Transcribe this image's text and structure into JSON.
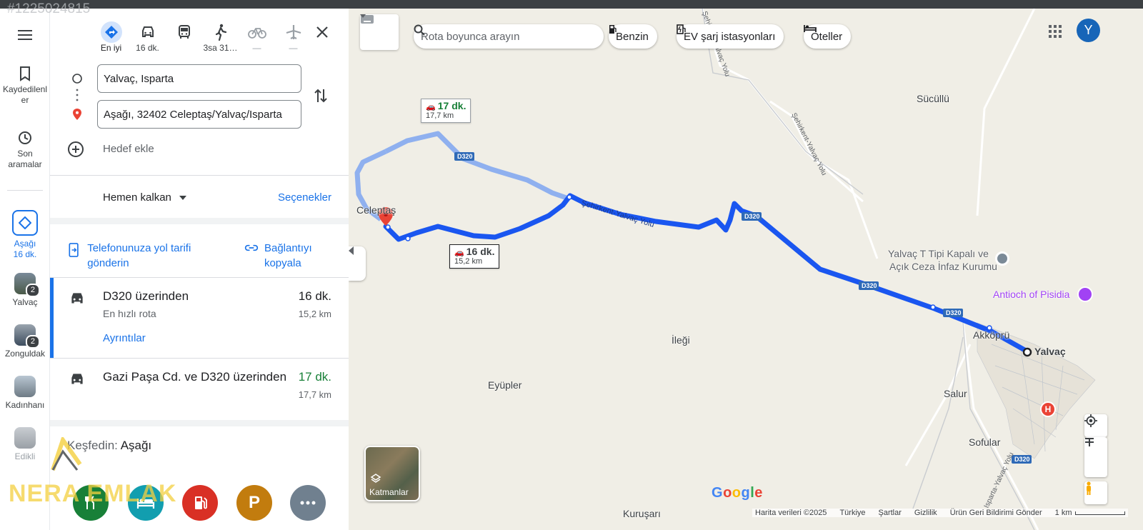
{
  "watermark_id": "#1225024815",
  "rail": {
    "saved_label": "Kaydedilenler",
    "recent_label": "Son aramalar",
    "current": {
      "label": "Aşağı",
      "sub": "16 dk."
    },
    "places": [
      {
        "label": "Yalvaç",
        "count": "2"
      },
      {
        "label": "Zonguldak",
        "count": "2"
      },
      {
        "label": "Kadınhanı",
        "count": ""
      },
      {
        "label": "Edikli",
        "count": ""
      }
    ]
  },
  "modes": [
    {
      "name": "best",
      "label": "En iyi",
      "icon": "directions-icon"
    },
    {
      "name": "car",
      "label": "16 dk.",
      "icon": "car-icon"
    },
    {
      "name": "transit",
      "label": "",
      "icon": "bus-icon"
    },
    {
      "name": "walk",
      "label": "3sa 31…",
      "icon": "walk-icon"
    },
    {
      "name": "bike",
      "label": "—",
      "icon": "bike-icon"
    },
    {
      "name": "flight",
      "label": "—",
      "icon": "plane-icon"
    }
  ],
  "origin": "Yalvaç, Isparta",
  "destination": "Aşağı, 32402 Celeptaş/Yalvaç/Isparta",
  "add_destination": "Hedef ekle",
  "depart_label": "Hemen kalkan",
  "options_label": "Seçenekler",
  "send_to_phone": "Telefonunuza yol tarifi gönderin",
  "copy_link": "Bağlantıyı kopyala",
  "routes": [
    {
      "title": "D320 üzerinden",
      "subtitle": "En hızlı rota",
      "time": "16 dk.",
      "distance": "15,2 km",
      "details": "Ayrıntılar",
      "selected": true
    },
    {
      "title": "Gazi Paşa Cd. ve D320 üzerinden",
      "subtitle": "",
      "time": "17 dk.",
      "distance": "17,7 km",
      "selected": false
    }
  ],
  "explore": {
    "prefix": "Keşfedin:",
    "place": "Aşağı"
  },
  "explore_buttons": [
    "restaurant",
    "hotel",
    "gas",
    "parking",
    "more"
  ],
  "map": {
    "search_placeholder": "Rota boyunca arayın",
    "chips": [
      "Benzin",
      "EV şarj istasyonları",
      "Oteller"
    ],
    "avatar": "Y",
    "callout_alt": {
      "time": "17 dk.",
      "distance": "17,7 km"
    },
    "callout_main": {
      "time": "16 dk.",
      "distance": "15,2 km"
    },
    "places": {
      "celeptas": "Celeptaş",
      "suculu": "Sücüllü",
      "prison1": "Yalvaç T Tipi Kapalı ve",
      "prison2": "Açık Ceza İnfaz Kurumu",
      "antioch": "Antioch of Pisidia",
      "akkopru": "Akköprü",
      "yalvac": "Yalvaç",
      "ilegi": "İleği",
      "eyupler": "Eyüpler",
      "salur": "Salur",
      "sofular": "Sofular",
      "kurusari": "Kuruşarı"
    },
    "roads": {
      "d320": "D320",
      "sehirkent": "Şehirkent-Yalvaç Yolu",
      "sparta": "Isparta-Yalvaç Yolu"
    },
    "layers_label": "Katmanlar",
    "google_logo": "Google",
    "footer": [
      "Harita verileri ©2025",
      "Türkiye",
      "Şartlar",
      "Gizlilik",
      "Ürün Geri Bildirimi Gönder"
    ],
    "scale": "1 km"
  },
  "watermark_logo": "NERA EMLAK",
  "colors": {
    "route": "#1a56f0",
    "alt_route": "#a8c0f5",
    "accent": "#1a73e8",
    "green": "#188038"
  }
}
